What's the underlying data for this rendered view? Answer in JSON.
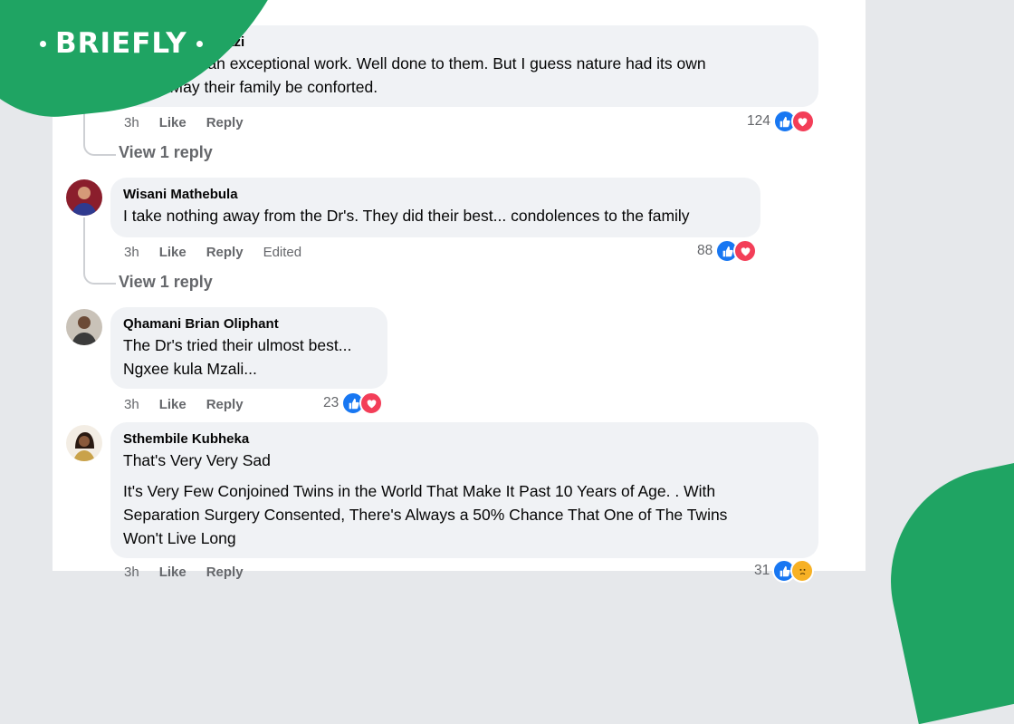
{
  "brand": {
    "name": "BRIEFLY"
  },
  "comments": [
    {
      "author": "Masadi Mkhwanazi",
      "lines": [
        "Doctors did an exceptional work. Well done to them. But I guess nature had its own",
        "plans. May their family be conforted."
      ],
      "time": "3h",
      "like": "Like",
      "reply": "Reply",
      "reaction_count": "124",
      "reactions": [
        "like-icon",
        "love-icon"
      ],
      "view_replies": "View 1 reply"
    },
    {
      "author": "Wisani Mathebula",
      "lines": [
        "I take nothing away from the Dr's. They did their best... condolences to the family"
      ],
      "time": "3h",
      "like": "Like",
      "reply": "Reply",
      "edited": "Edited",
      "reaction_count": "88",
      "reactions": [
        "like-icon",
        "love-icon"
      ],
      "view_replies": "View 1 reply"
    },
    {
      "author": "Qhamani Brian Oliphant",
      "lines": [
        "The Dr's tried their ulmost best...",
        "Ngxee kula Mzali..."
      ],
      "time": "3h",
      "like": "Like",
      "reply": "Reply",
      "reaction_count": "23",
      "reactions": [
        "like-icon",
        "love-icon"
      ]
    },
    {
      "author": "Sthembile Kubheka",
      "lines": [
        "That's Very Very Sad",
        "",
        "It's Very Few Conjoined Twins in the World That Make It Past 10 Years of Age. . With",
        "Separation Surgery Consented, There's Always a 50% Chance That One of The Twins",
        "Won't Live Long"
      ],
      "time": "3h",
      "like": "Like",
      "reply": "Reply",
      "reaction_count": "31",
      "reactions": [
        "like-icon",
        "sad-icon"
      ]
    }
  ],
  "colors": {
    "brand_green": "#1fa463",
    "bubble": "#f0f2f5",
    "like": "#1877f2",
    "love": "#f33e58"
  }
}
